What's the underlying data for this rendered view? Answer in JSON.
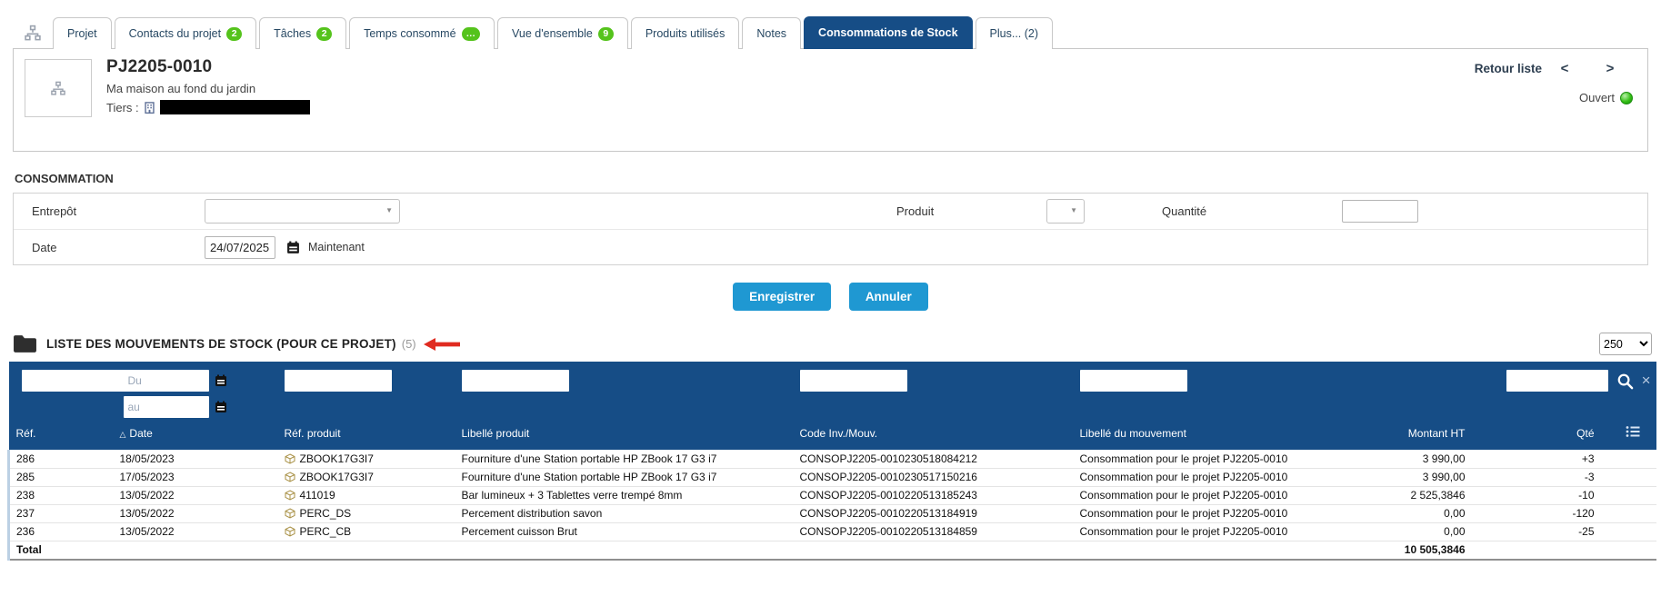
{
  "colors": {
    "header_navy": "#164d86",
    "badge_green": "#55c31c",
    "button_blue": "#1f98d2",
    "status_green": "#2eb82e",
    "annotation_red": "#e02b20"
  },
  "glyphs": {
    "caret": "▼",
    "clear": "×",
    "sort_asc": "△",
    "prev": "<",
    "next": ">"
  },
  "tabs": {
    "items": [
      {
        "label": "Projet"
      },
      {
        "label": "Contacts du projet",
        "badge": "2"
      },
      {
        "label": "Tâches",
        "badge": "2"
      },
      {
        "label": "Temps consommé",
        "badge": "…"
      },
      {
        "label": "Vue d'ensemble",
        "badge": "9"
      },
      {
        "label": "Produits utilisés"
      },
      {
        "label": "Notes"
      },
      {
        "label": "Consommations de Stock"
      },
      {
        "label": "Plus... (2)"
      }
    ]
  },
  "banner": {
    "ref": "PJ2205-0010",
    "title": "Ma maison au fond du jardin",
    "thirdparty_label": "Tiers :",
    "back_to_list": "Retour liste",
    "status_label": "Ouvert"
  },
  "consumption_form": {
    "section_title": "CONSOMMATION",
    "warehouse_label": "Entrepôt",
    "product_label": "Produit",
    "quantity_label": "Quantité",
    "quantity_value": "",
    "date_label": "Date",
    "date_value": "24/07/2025",
    "now_label": "Maintenant",
    "save_label": "Enregistrer",
    "cancel_label": "Annuler"
  },
  "movements": {
    "title": "LISTE DES MOUVEMENTS DE STOCK (POUR CE PROJET)",
    "count": "(5)",
    "page_size": "250",
    "filters": {
      "date_from_placeholder": "Du",
      "date_to_placeholder": "au"
    },
    "columns": {
      "ref": "Réf.",
      "date": "Date",
      "product_ref": "Réf. produit",
      "product_label": "Libellé produit",
      "code": "Code Inv./Mouv.",
      "movement_label": "Libellé du mouvement",
      "amount": "Montant HT",
      "qty": "Qté"
    },
    "rows": [
      {
        "ref": "286",
        "date": "18/05/2023",
        "product_ref": "ZBOOK17G3I7",
        "product_label": "Fourniture d'une Station portable HP ZBook 17 G3 i7",
        "code": "CONSOPJ2205-0010230518084212",
        "movement_label": "Consommation pour le projet PJ2205-0010",
        "amount": "3 990,00",
        "qty": "+3"
      },
      {
        "ref": "285",
        "date": "17/05/2023",
        "product_ref": "ZBOOK17G3I7",
        "product_label": "Fourniture d'une Station portable HP ZBook 17 G3 i7",
        "code": "CONSOPJ2205-0010230517150216",
        "movement_label": "Consommation pour le projet PJ2205-0010",
        "amount": "3 990,00",
        "qty": "-3"
      },
      {
        "ref": "238",
        "date": "13/05/2022",
        "product_ref": "411019",
        "product_label": "Bar lumineux + 3 Tablettes verre trempé 8mm",
        "code": "CONSOPJ2205-0010220513185243",
        "movement_label": "Consommation pour le projet PJ2205-0010",
        "amount": "2 525,3846",
        "qty": "-10"
      },
      {
        "ref": "237",
        "date": "13/05/2022",
        "product_ref": "PERC_DS",
        "product_label": "Percement distribution savon",
        "code": "CONSOPJ2205-0010220513184919",
        "movement_label": "Consommation pour le projet PJ2205-0010",
        "amount": "0,00",
        "qty": "-120"
      },
      {
        "ref": "236",
        "date": "13/05/2022",
        "product_ref": "PERC_CB",
        "product_label": "Percement cuisson Brut",
        "code": "CONSOPJ2205-0010220513184859",
        "movement_label": "Consommation pour le projet PJ2205-0010",
        "amount": "0,00",
        "qty": "-25"
      }
    ],
    "total_label": "Total",
    "total_amount": "10 505,3846"
  }
}
